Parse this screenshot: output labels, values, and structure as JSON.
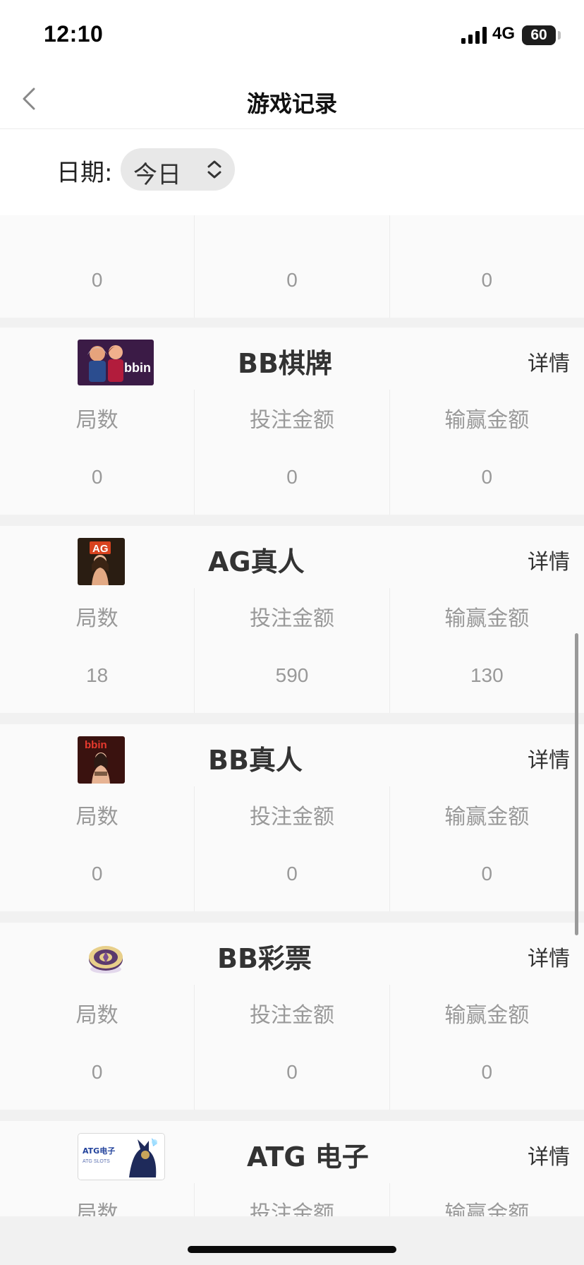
{
  "status_bar": {
    "time": "12:10",
    "network": "4G",
    "battery": "60"
  },
  "nav": {
    "title": "游戏记录",
    "back_icon": "chevron-left-icon"
  },
  "filter": {
    "date_label": "日期:",
    "date_value": "今日",
    "select_icon": "up-down-chevron-icon"
  },
  "stat_labels": {
    "rounds": "局数",
    "bet_amount": "投注金额",
    "win_loss": "输赢金额"
  },
  "cards": [
    {
      "name": "",
      "detail": "",
      "values": [
        "0",
        "0",
        "0"
      ],
      "labels_clipped": true
    },
    {
      "name": "BB棋牌",
      "detail": "详情",
      "values": [
        "0",
        "0",
        "0"
      ]
    },
    {
      "name": "AG真人",
      "detail": "详情",
      "values": [
        "18",
        "590",
        "130"
      ]
    },
    {
      "name": "BB真人",
      "detail": "详情",
      "values": [
        "0",
        "0",
        "0"
      ]
    },
    {
      "name": "BB彩票",
      "detail": "详情",
      "values": [
        "0",
        "0",
        "0"
      ]
    },
    {
      "name": "ATG 电子",
      "detail": "详情",
      "logo_text": [
        "ATG电子",
        "ATG SLOTS"
      ]
    }
  ],
  "colors": {
    "background": "#f1f1f1",
    "card": "#fafafa",
    "muted_text": "#999999",
    "title_text": "#333333"
  }
}
